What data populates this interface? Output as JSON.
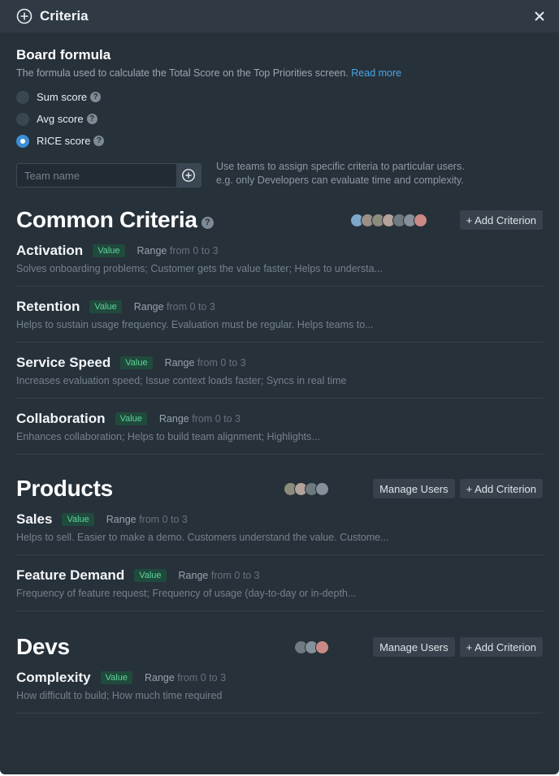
{
  "header": {
    "title": "Criteria",
    "icon": "plus-circle-icon",
    "close_icon": "close-icon"
  },
  "board_formula": {
    "title": "Board formula",
    "description": "The formula used to calculate the Total Score on the Top Priorities screen.",
    "read_more": "Read more",
    "options": [
      {
        "label": "Sum score",
        "checked": false
      },
      {
        "label": "Avg score",
        "checked": false
      },
      {
        "label": "RICE score",
        "checked": true
      }
    ]
  },
  "team": {
    "placeholder": "Team name",
    "hint_line1": "Use teams to assign specific criteria to particular users.",
    "hint_line2": "e.g. only Developers can evaluate time and complexity."
  },
  "labels": {
    "help": "?",
    "range": "Range",
    "manage_users": "Manage Users",
    "add_criterion": "+ Add Criterion"
  },
  "sections": [
    {
      "title": "Common Criteria",
      "avatars": 7,
      "criteria": [
        {
          "name": "Activation",
          "tag": "Value",
          "range": "from 0 to 3",
          "desc": "Solves onboarding problems; Customer gets the value faster; Helps to understa..."
        },
        {
          "name": "Retention",
          "tag": "Value",
          "range": "from 0 to 3",
          "desc": "Helps to sustain usage frequency. Evaluation must be regular. Helps teams to..."
        },
        {
          "name": "Service Speed",
          "tag": "Value",
          "range": "from 0 to 3",
          "desc": "Increases evaluation speed; Issue context loads faster; Syncs in real time"
        },
        {
          "name": "Collaboration",
          "tag": "Value",
          "range": "from 0 to 3",
          "desc": "Enhances collaboration; Helps to build team alignment; Highlights..."
        }
      ]
    },
    {
      "title": "Products",
      "avatars": 4,
      "criteria": [
        {
          "name": "Sales",
          "tag": "Value",
          "range": "from 0 to 3",
          "desc": "Helps to sell. Easier to make a demo. Customers understand the value. Custome..."
        },
        {
          "name": "Feature Demand",
          "tag": "Value",
          "range": "from 0 to 3",
          "desc": "Frequency of feature request; Frequency of usage (day-to-day or in-depth..."
        }
      ]
    },
    {
      "title": "Devs",
      "avatars": 3,
      "criteria": [
        {
          "name": "Complexity",
          "tag": "Value",
          "range": "from 0 to 3",
          "desc": "How difficult to build; How much time required"
        }
      ]
    }
  ],
  "colors": {
    "background": "#27313a",
    "accent": "#3b8ed8",
    "link": "#4aa8e8",
    "tag": "#5fd39a"
  }
}
